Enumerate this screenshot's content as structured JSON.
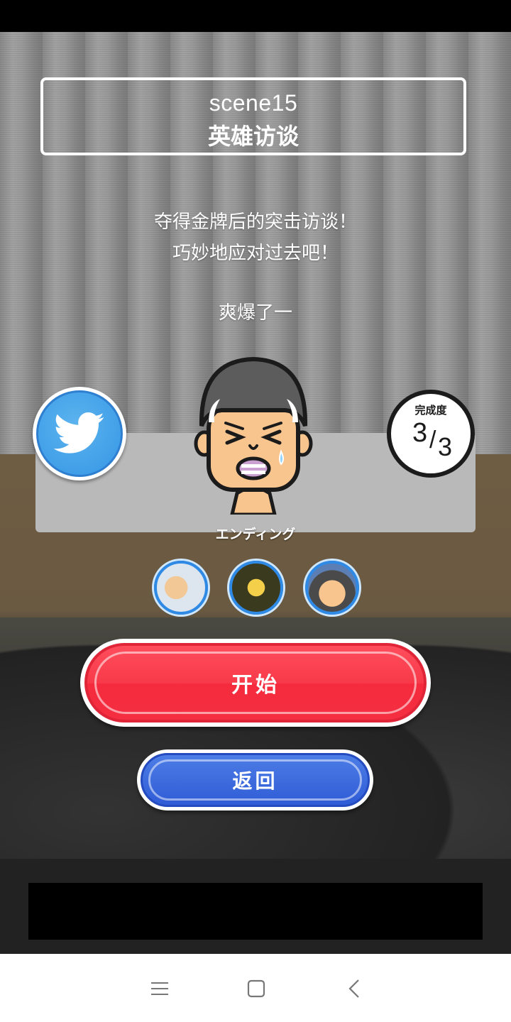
{
  "scene": {
    "number": "scene15",
    "title": "英雄访谈"
  },
  "description": {
    "line1": "夺得金牌后的突击访谈！",
    "line2": "巧妙地应对过去吧！",
    "line3": "爽爆了一"
  },
  "share": {
    "icon": "twitter-bird-icon",
    "color": "#3a9be8"
  },
  "completion": {
    "label": "完成度",
    "current": "3",
    "slash": "/",
    "total": "3"
  },
  "ending": {
    "label": "エンディング",
    "thumbnails": [
      {
        "icon": "ending-1-thumbnail"
      },
      {
        "icon": "ending-2-thumbnail"
      },
      {
        "icon": "ending-3-thumbnail"
      }
    ]
  },
  "buttons": {
    "start_label": "开始",
    "back_label": "返回",
    "start_color": "#f83a4a",
    "back_color": "#3a68dc"
  },
  "nav": {
    "menu_icon": "menu-icon",
    "home_icon": "home-square-icon",
    "back_icon": "back-chevron-icon"
  }
}
